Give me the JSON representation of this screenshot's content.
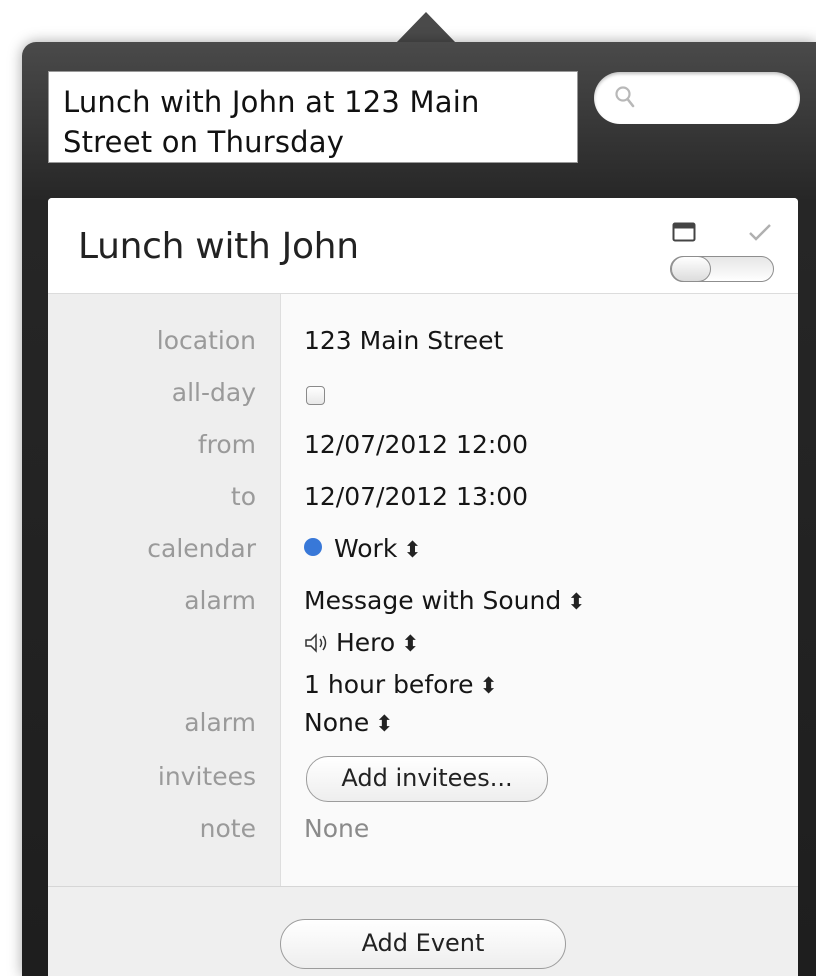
{
  "quick_entry": {
    "text": "Lunch with John at 123 Main Street on Thursday"
  },
  "search": {
    "placeholder": ""
  },
  "event": {
    "title": "Lunch with John",
    "fields": {
      "location_label": "location",
      "location_value": "123 Main Street",
      "allday_label": "all-day",
      "allday_checked": false,
      "from_label": "from",
      "from_value": "12/07/2012 12:00",
      "to_label": "to",
      "to_value": "12/07/2012 13:00",
      "calendar_label": "calendar",
      "calendar_value": "Work",
      "calendar_color": "#3878d8",
      "alarm_label": "alarm",
      "alarm_type": "Message with Sound",
      "alarm_sound": "Hero",
      "alarm_offset": "1 hour before",
      "alarm2_label": "alarm",
      "alarm2_value": "None",
      "invitees_label": "invitees",
      "invitees_button": "Add invitees...",
      "note_label": "note",
      "note_value": "None"
    }
  },
  "footer": {
    "add_button": "Add Event"
  },
  "icons": {
    "search": "search-icon",
    "view_toggle": "calendar-view-icon",
    "done": "checkmark-icon",
    "sound": "speaker-icon",
    "stepper": "updown-stepper-icon"
  }
}
